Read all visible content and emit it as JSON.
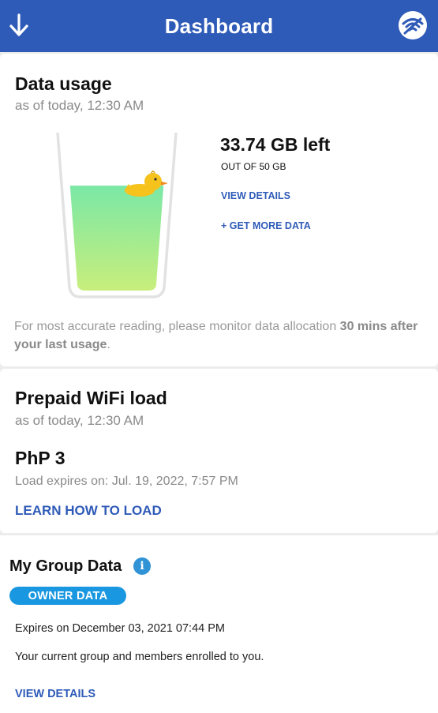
{
  "header": {
    "title": "Dashboard",
    "left_icon": "arrow-down-icon",
    "right_icon": "wifi-icon",
    "color": "#2f5bb8"
  },
  "data_usage": {
    "title": "Data usage",
    "as_of": "as of today, 12:30 AM",
    "remaining": "33.74 GB left",
    "out_of": "OUT OF 50 GB",
    "view_details": "VIEW DETAILS",
    "get_more": "+ GET MORE DATA",
    "fill_fraction": 0.6748,
    "note_prefix": "For most accurate reading, please monitor data allocation ",
    "note_bold": "30 mins after your last usage",
    "note_suffix": "."
  },
  "prepaid_load": {
    "title": "Prepaid WiFi load",
    "as_of": "as of today, 12:30 AM",
    "amount": "PhP 3",
    "expires": "Load expires on: Jul. 19, 2022, 7:57 PM",
    "learn_link": "LEARN HOW TO LOAD"
  },
  "group_data": {
    "title": "My Group Data",
    "info_icon": "i",
    "badge": "OWNER DATA",
    "expires": "Expires on December 03, 2021 07:44 PM",
    "description": "Your current group and members enrolled to you.",
    "view_details": "VIEW DETAILS"
  }
}
